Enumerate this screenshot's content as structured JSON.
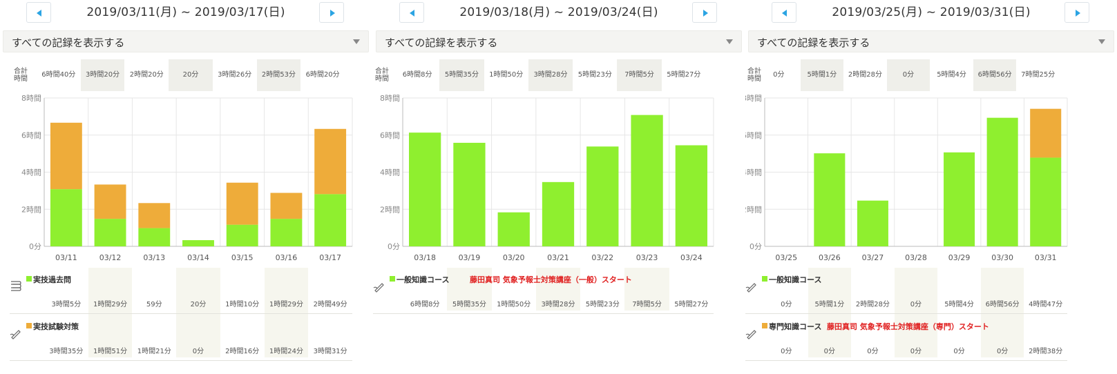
{
  "colors": {
    "general": "#8fef2f",
    "special": "#eeac3a",
    "accent": "#2ba4e3",
    "note": "#e02020"
  },
  "panels": [
    {
      "range": "2019/03/11(月) ~ 2019/03/17(日)",
      "filter_label": "すべての記録を表示する",
      "totals_label": "合計時間",
      "totals": [
        "6時間40分",
        "3時間20分",
        "2時間20分",
        "20分",
        "3時間26分",
        "2時間53分",
        "6時間20分"
      ],
      "courses": [
        {
          "name": "実技過去問",
          "color": "#8fef2f",
          "icon": "book-stack-icon",
          "note": "",
          "values": [
            "3時間5分",
            "1時間29分",
            "59分",
            "20分",
            "1時間10分",
            "1時間29分",
            "2時間49分"
          ]
        },
        {
          "name": "実技試験対策",
          "color": "#eeac3a",
          "icon": "pen-icon",
          "note": "",
          "values": [
            "3時間35分",
            "1時間51分",
            "1時間21分",
            "0分",
            "2時間16分",
            "1時間24分",
            "3時間31分"
          ]
        }
      ],
      "chart_data": {
        "type": "bar",
        "stacked": true,
        "categories": [
          "03/11",
          "03/12",
          "03/13",
          "03/14",
          "03/15",
          "03/16",
          "03/17"
        ],
        "yticks": [
          "0分",
          "2時間",
          "4時間",
          "6時間",
          "8時間"
        ],
        "ylim": [
          0,
          480
        ],
        "grid": true,
        "series": [
          {
            "name": "実技過去問",
            "color": "#8fef2f",
            "values": [
              185,
              89,
              59,
              20,
              70,
              89,
              169
            ]
          },
          {
            "name": "実技試験対策",
            "color": "#eeac3a",
            "values": [
              215,
              111,
              81,
              0,
              136,
              84,
              211
            ]
          }
        ]
      }
    },
    {
      "range": "2019/03/18(月) ~ 2019/03/24(日)",
      "filter_label": "すべての記録を表示する",
      "totals_label": "合計時間",
      "totals": [
        "6時間8分",
        "5時間35分",
        "1時間50分",
        "3時間28分",
        "5時間23分",
        "7時間5分",
        "5時間27分"
      ],
      "courses": [
        {
          "name": "一般知識コース",
          "color": "#8fef2f",
          "icon": "pen-icon",
          "note": "藤田真司 気象予報士対策講座（一般）スタート",
          "values": [
            "6時間8分",
            "5時間35分",
            "1時間50分",
            "3時間28分",
            "5時間23分",
            "7時間5分",
            "5時間27分"
          ]
        }
      ],
      "chart_data": {
        "type": "bar",
        "stacked": true,
        "categories": [
          "03/18",
          "03/19",
          "03/20",
          "03/21",
          "03/22",
          "03/23",
          "03/24"
        ],
        "yticks": [
          "0分",
          "2時間",
          "4時間",
          "6時間",
          "8時間"
        ],
        "ylim": [
          0,
          480
        ],
        "grid": true,
        "series": [
          {
            "name": "一般知識コース",
            "color": "#8fef2f",
            "values": [
              368,
              335,
              110,
              208,
              323,
              425,
              327
            ]
          }
        ]
      }
    },
    {
      "range": "2019/03/25(月) ~ 2019/03/31(日)",
      "filter_label": "すべての記録を表示する",
      "totals_label": "合計時間",
      "totals": [
        "0分",
        "5時間1分",
        "2時間28分",
        "0分",
        "5時間4分",
        "6時間56分",
        "7時間25分"
      ],
      "courses": [
        {
          "name": "一般知識コース",
          "color": "#8fef2f",
          "icon": "pen-icon",
          "note": "",
          "values": [
            "0分",
            "5時間1分",
            "2時間28分",
            "0分",
            "5時間4分",
            "6時間56分",
            "4時間47分"
          ]
        },
        {
          "name": "専門知識コース",
          "color": "#eeac3a",
          "icon": "pen-icon",
          "note": "藤田真司 気象予報士対策講座（専門）スタート",
          "values": [
            "0分",
            "0分",
            "0分",
            "0分",
            "0分",
            "0分",
            "2時間38分"
          ]
        }
      ],
      "chart_data": {
        "type": "bar",
        "stacked": true,
        "categories": [
          "03/25",
          "03/26",
          "03/27",
          "03/28",
          "03/29",
          "03/30",
          "03/31"
        ],
        "yticks": [
          "0分",
          "2時間",
          "4時間",
          "6時間",
          "8時間"
        ],
        "ylim": [
          0,
          480
        ],
        "grid": true,
        "series": [
          {
            "name": "一般知識コース",
            "color": "#8fef2f",
            "values": [
              0,
              301,
              148,
              0,
              304,
              416,
              287
            ]
          },
          {
            "name": "専門知識コース",
            "color": "#eeac3a",
            "values": [
              0,
              0,
              0,
              0,
              0,
              0,
              158
            ]
          }
        ]
      }
    }
  ]
}
